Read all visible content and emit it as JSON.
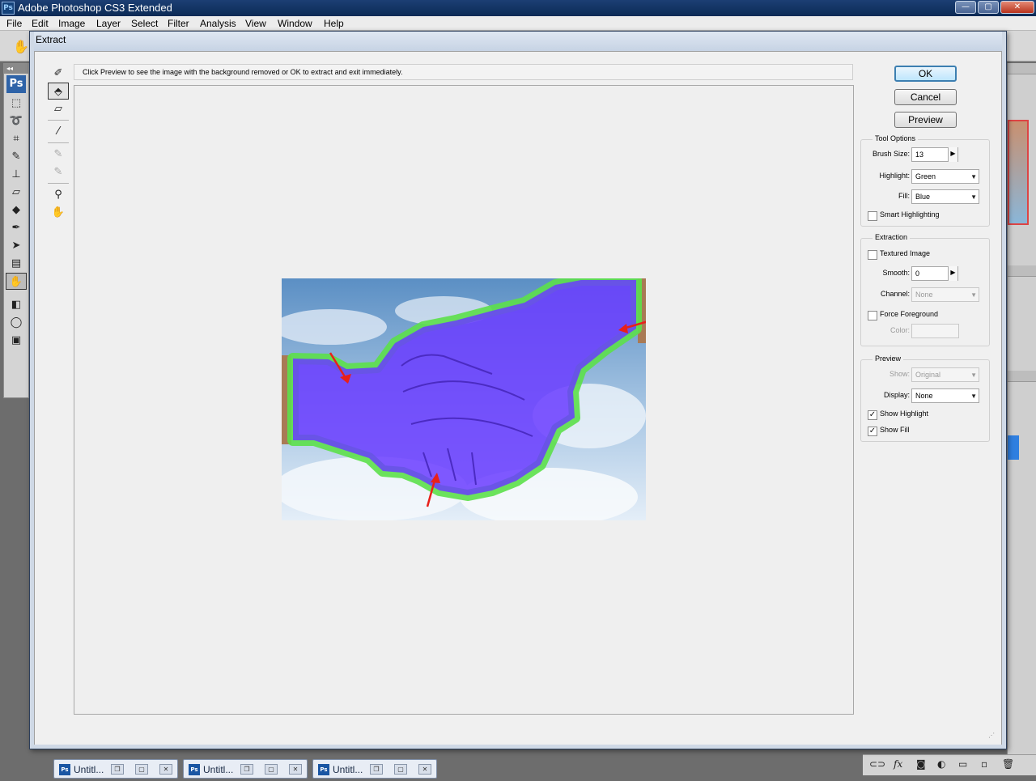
{
  "app": {
    "title": "Adobe Photoshop CS3 Extended",
    "icon": "ps-icon"
  },
  "window_buttons": {
    "minimize": "—",
    "maximize": "▢",
    "close": "✕"
  },
  "menu": [
    "File",
    "Edit",
    "Image",
    "Layer",
    "Select",
    "Filter",
    "Analysis",
    "View",
    "Window",
    "Help"
  ],
  "dialog": {
    "title": "Extract",
    "instructions": "Click Preview to see the image with the background removed or OK to extract and exit immediately.",
    "buttons": {
      "ok": "OK",
      "cancel": "Cancel",
      "preview": "Preview"
    },
    "tool_options": {
      "title": "Tool Options",
      "brush_size_label": "Brush Size:",
      "brush_size": "13",
      "highlight_label": "Highlight:",
      "highlight": "Green",
      "fill_label": "Fill:",
      "fill": "Blue",
      "smart_highlighting": "Smart Highlighting",
      "smart_highlighting_checked": false
    },
    "extraction": {
      "title": "Extraction",
      "textured_image": "Textured Image",
      "textured_image_checked": false,
      "smooth_label": "Smooth:",
      "smooth": "0",
      "channel_label": "Channel:",
      "channel": "None",
      "force_foreground": "Force Foreground",
      "force_foreground_checked": false,
      "color_label": "Color:"
    },
    "preview": {
      "title": "Preview",
      "show_label": "Show:",
      "show": "Original",
      "display_label": "Display:",
      "display": "None",
      "show_highlight": "Show Highlight",
      "show_highlight_checked": true,
      "show_fill": "Show Fill",
      "show_fill_checked": true
    },
    "tools": [
      "edge-highlighter-icon",
      "fill-icon",
      "eraser-icon",
      "eyedropper-icon",
      "cleanup-icon",
      "edge-touchup-icon",
      "zoom-icon",
      "hand-icon"
    ],
    "colors": {
      "highlight": "#5ce04a",
      "fill": "#6a3cff",
      "arrow": "#e8201a"
    }
  },
  "taskbar": {
    "docs": [
      {
        "name": "Untitl..."
      },
      {
        "name": "Untitl..."
      },
      {
        "name": "Untitl..."
      }
    ]
  },
  "icons": {
    "check": "✓",
    "dropdown": "▼",
    "spin": "▶"
  }
}
